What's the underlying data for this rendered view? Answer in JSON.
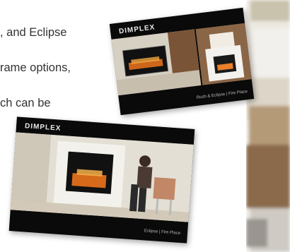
{
  "text_lines": [
    ", and Eclipse",
    "rame options,",
    "ch can be"
  ],
  "card_top": {
    "logo": "DIMPLEX",
    "caption": "Rush & Eclipse | Fire Place"
  },
  "card_bottom": {
    "logo": "DIMPLEX",
    "caption": "Eclipse | Fire Place"
  },
  "colors": {
    "card_bg": "#0a0a0a",
    "fire": "#e0701c",
    "wall": "#d8d2c4"
  }
}
